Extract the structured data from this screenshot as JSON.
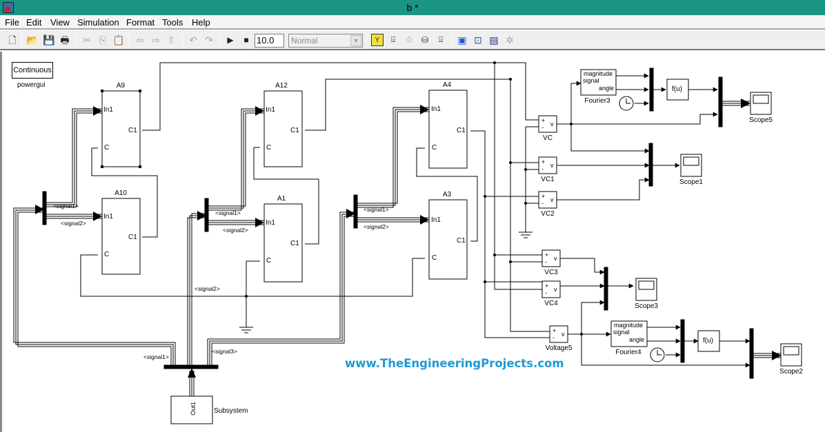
{
  "window": {
    "title": "b *"
  },
  "menu": [
    "File",
    "Edit",
    "View",
    "Simulation",
    "Format",
    "Tools",
    "Help"
  ],
  "toolbar": {
    "buttons": [
      {
        "name": "new-model",
        "icon": "new-file-icon",
        "enabled": true
      },
      {
        "name": "open",
        "icon": "folder-open-icon",
        "enabled": true
      },
      {
        "name": "save",
        "icon": "floppy-save-icon",
        "enabled": true
      },
      {
        "name": "print",
        "icon": "printer-icon",
        "enabled": true
      },
      {
        "name": "cut",
        "icon": "scissors-icon",
        "enabled": false
      },
      {
        "name": "copy",
        "icon": "copy-icon",
        "enabled": false
      },
      {
        "name": "paste",
        "icon": "paste-icon",
        "enabled": false
      },
      {
        "name": "back",
        "icon": "arrow-left-icon",
        "enabled": false
      },
      {
        "name": "forward",
        "icon": "arrow-right-icon",
        "enabled": false
      },
      {
        "name": "up",
        "icon": "arrow-up-icon",
        "enabled": false
      },
      {
        "name": "undo",
        "icon": "undo-icon",
        "enabled": false
      },
      {
        "name": "redo",
        "icon": "redo-icon",
        "enabled": false
      },
      {
        "name": "start-simulation",
        "icon": "play-icon",
        "enabled": true
      },
      {
        "name": "stop-simulation",
        "icon": "stop-icon",
        "enabled": true
      }
    ],
    "stop_time": "10.0",
    "sim_mode": "Normal",
    "tools": [
      {
        "name": "model-advisor",
        "icon": "model-advisor-icon"
      },
      {
        "name": "update-diagram",
        "icon": "update-diagram-icon"
      },
      {
        "name": "build",
        "icon": "build-icon"
      },
      {
        "name": "incremental-build",
        "icon": "incremental-build-icon"
      },
      {
        "name": "refresh-blocks",
        "icon": "refresh-blocks-icon"
      },
      {
        "name": "library-browser",
        "icon": "library-browser-icon"
      },
      {
        "name": "model-explorer",
        "icon": "model-explorer-icon"
      },
      {
        "name": "debugger",
        "icon": "debugger-icon"
      },
      {
        "name": "profiler",
        "icon": "profiler-icon"
      }
    ]
  },
  "diagram": {
    "powergui": {
      "label": "Continuous",
      "name": "powergui"
    },
    "blocks": {
      "A9": {
        "name": "A9",
        "in": "In1",
        "c": "C",
        "out": "C1"
      },
      "A10": {
        "name": "A10",
        "in": "In1",
        "c": "C",
        "out": "C1"
      },
      "A12": {
        "name": "A12",
        "in": "In1",
        "c": "C",
        "out": "C1"
      },
      "A1": {
        "name": "A1",
        "in": "In1",
        "c": "C",
        "out": "C1"
      },
      "A4": {
        "name": "A4",
        "in": "In1",
        "c": "C",
        "out": "C1"
      },
      "A3": {
        "name": "A3",
        "in": "In1",
        "c": "C",
        "out": "C1"
      }
    },
    "voltmeters": [
      {
        "name": "VC",
        "plus": "+",
        "minus": "-",
        "out": "v"
      },
      {
        "name": "VC1",
        "plus": "+",
        "minus": "-",
        "out": "v"
      },
      {
        "name": "VC2",
        "plus": "+",
        "minus": "-",
        "out": "v"
      },
      {
        "name": "VC3",
        "plus": "+",
        "minus": "-",
        "out": "v"
      },
      {
        "name": "VC4",
        "plus": "+",
        "minus": "-",
        "out": "v"
      },
      {
        "name": "Voltage5",
        "plus": "+",
        "minus": "-",
        "out": "v"
      }
    ],
    "fourier": [
      {
        "name": "Fourier3",
        "in": "signal",
        "out1": "magnitude",
        "out2": "angle"
      },
      {
        "name": "Fourier4",
        "in": "signal",
        "out1": "magnitude",
        "out2": "angle"
      }
    ],
    "fcn": [
      "f(u)",
      "f(u)"
    ],
    "scopes": [
      "Scope5",
      "Scope1",
      "Scope3",
      "Scope2"
    ],
    "subsystem": {
      "name": "Subsystem",
      "port": "Out1"
    },
    "signals": {
      "s1": "<signal1>",
      "s2": "<signal2>",
      "s3": "<signal3>"
    }
  },
  "watermark": "www.TheEngineeringProjects.com"
}
